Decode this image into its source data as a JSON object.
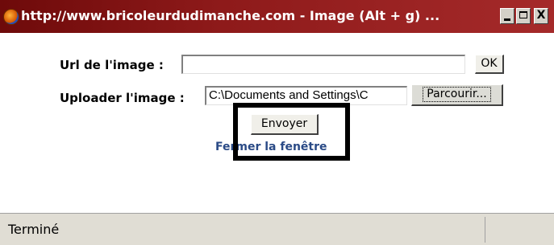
{
  "window": {
    "title": "http://www.bricoleurdudimanche.com - Image (Alt + g) ...",
    "min_glyph": "",
    "max_glyph": "",
    "close_glyph": "X"
  },
  "form": {
    "url_label": "Url de l'image :",
    "url_value": "",
    "ok_label": "OK",
    "upload_label": "Uploader l'image :",
    "upload_value": "C:\\Documents and Settings\\C",
    "browse_label": "Parcourir...",
    "send_label": "Envoyer",
    "close_link": "Fermer la fenêtre"
  },
  "status": {
    "text": "Terminé"
  },
  "colors": {
    "titlebar": "#8e1a1a",
    "link": "#2a4a86",
    "highlight": "#000000"
  },
  "icons": {
    "app": "firefox-icon"
  }
}
